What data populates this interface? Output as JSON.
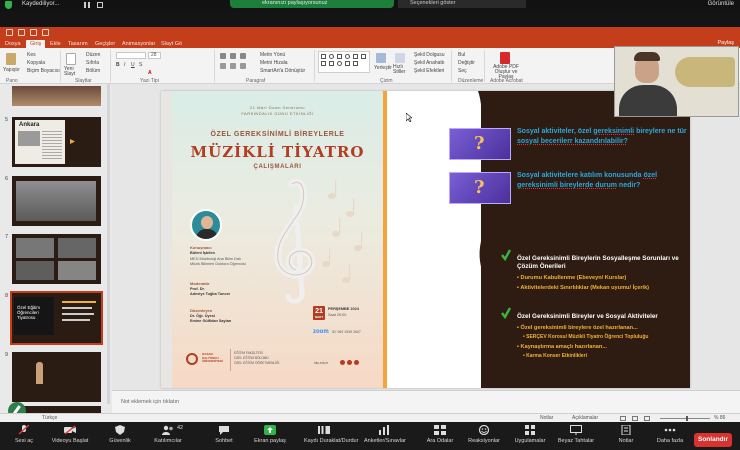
{
  "zoom_top": {
    "recording_label": "Kaydediliyor...",
    "share_banner": "ekranınızı paylaşıyorsunuz",
    "share_menu": "Seçenekleri göster",
    "view_label": "Görüntüle"
  },
  "ppt": {
    "tabs": [
      "Dosya",
      "Giriş",
      "Ekle",
      "Tasarım",
      "Geçişler",
      "Animasyonlar",
      "Slayt Gö"
    ],
    "active_tab": "Giriş",
    "share": "Paylaş",
    "ribbon": {
      "cut": "Kes",
      "copy": "Kopyala",
      "paste": "Yapıştır",
      "format_painter": "Biçim Boyacısı",
      "new_slide": "Yeni Slayt",
      "layout": "Düzen",
      "reset": "Sıfırla",
      "section": "Bölüm",
      "font_size": "28",
      "text_direction": "Metin Yönü",
      "align_text": "Metni Hizala",
      "smartart": "SmartArt'a Dönüştür",
      "arrange": "Yerleştir",
      "quick_styles": "Hızlı Stiller",
      "shape_fill": "Şekil Dolgusu",
      "shape_outline": "Şekil Anahattı",
      "shape_effects": "Şekil Efektleri",
      "find": "Bul",
      "replace": "Değiştir",
      "select": "Seç",
      "adobe_pdf": "Adobe PDF Oluştur ve Paylaş",
      "groups": [
        "Pano",
        "Slaytlar",
        "Yazı Tipi",
        "Paragraf",
        "Çizim",
        "Düzenleme",
        "Adobe Acrobat"
      ]
    },
    "thumbnail_numbers": [
      "5",
      "6",
      "7",
      "8",
      "9"
    ],
    "thumbnail_5_text": "Ankara",
    "thumbnail_8_title": "Özel Eğitim Öğrencileri Tiyatrosu",
    "notes_placeholder": "Not eklemek için tıklatın",
    "status": {
      "language": "Türkçe",
      "notes": "Notlar",
      "comments": "Açıklamalar",
      "zoom": "% 86"
    }
  },
  "poster": {
    "event_date_line": "21 Mart Down Sendromu",
    "event_line2": "FARKINDALIK GÜNÜ ETKİNLİĞİ",
    "subtitle": "ÖZEL GEREKSİNİMLİ BİREYLERLE",
    "title": "MÜZİKLİ TİYATRO",
    "title2": "ÇALIŞMALARI",
    "speaker_label": "Konuşmacı",
    "speaker_name": "Bülent İşbilen",
    "speaker_desc1": "MEÜ Müzikoloji Ana Bilim Dalı",
    "speaker_desc2": "Müzik Bilimleri Doktora Öğrencisi",
    "moderator_label": "Moderatör",
    "moderator_title": "Prof. Dr.",
    "moderator_name": "Adeviye Tuğba Tuncer",
    "organizers_label": "Düzenleyen",
    "organizer_title": "Dr. Öğr. Üyesi",
    "organizer_name": "Emine Gülfidan Saylan",
    "day": "21",
    "month": "MART",
    "weekday": "PERŞEMBE 2024",
    "time": "Saat 20:00",
    "zoom_label": "zoom",
    "zoom_id": "ID: 992 1939 2607",
    "university": "HASAN KALYONCU ÜNİVERSİTESİ",
    "faculty1": "EĞİTİM FAKÜLTESİ",
    "faculty2": "ÖZEL EĞİTİM BÖLÜMÜ",
    "faculty3": "ÖZEL EĞİTİM ÖĞRETMENLİĞİ",
    "web": "hku.edu.tr"
  },
  "slide_right": {
    "q1_pre": "Sosyal aktiviteler, özel ",
    "q1_u1": "gereksinimli",
    "q1_mid": " bireylere ne tür ",
    "q1_u2": "sosyal becerilerr kazandırılabilir?",
    "q2_pre": "Sosyal aktivitelere katılım konusunda ",
    "q2_u1": "özel gereksinimli bireylerde durum",
    "q2_post": " nedir?",
    "sec1_title": "Özel Gereksinimli Bireylerin Sosyalleşme Sorunları ve Çözüm Önerileri",
    "sec1_b1": "Durumu Kabullenme   (Ebeveyn/ Kurslar)",
    "sec1_b2": "Aktivitelerdeki Sınırlılıklar   (Mekan uyumu/ İçerik)",
    "sec2_title": "Özel Gereksinimli Bireyler ve Sosyal Aktiviteler",
    "sec2_b1": "Özel gereksinimli bireylere özel hazırlanan...",
    "sec2_b1a": "SERÇEV Korosu/ Müzikli Tiyatro Öğrenci Topluluğu",
    "sec2_b2": "Kaynaştırma amaçlı hazırlanan...",
    "sec2_b2a": "Karma Konser Etkinlikleri"
  },
  "zoom_bar": {
    "items": [
      "Sesi aç",
      "Videoyu Başlat",
      "Güvenlik",
      "Katılımcılar",
      "Sohbet",
      "Ekran paylaş",
      "Kaydı Duraklat/Durdur",
      "Anketler/Sınavlar",
      "Ara Odalar",
      "Reaksiyonlar",
      "Uygulamalar",
      "Beyaz Tahtalar",
      "Notlar",
      "Daha fazla"
    ],
    "participants_count": "42",
    "end_button": "Sonlandır"
  }
}
